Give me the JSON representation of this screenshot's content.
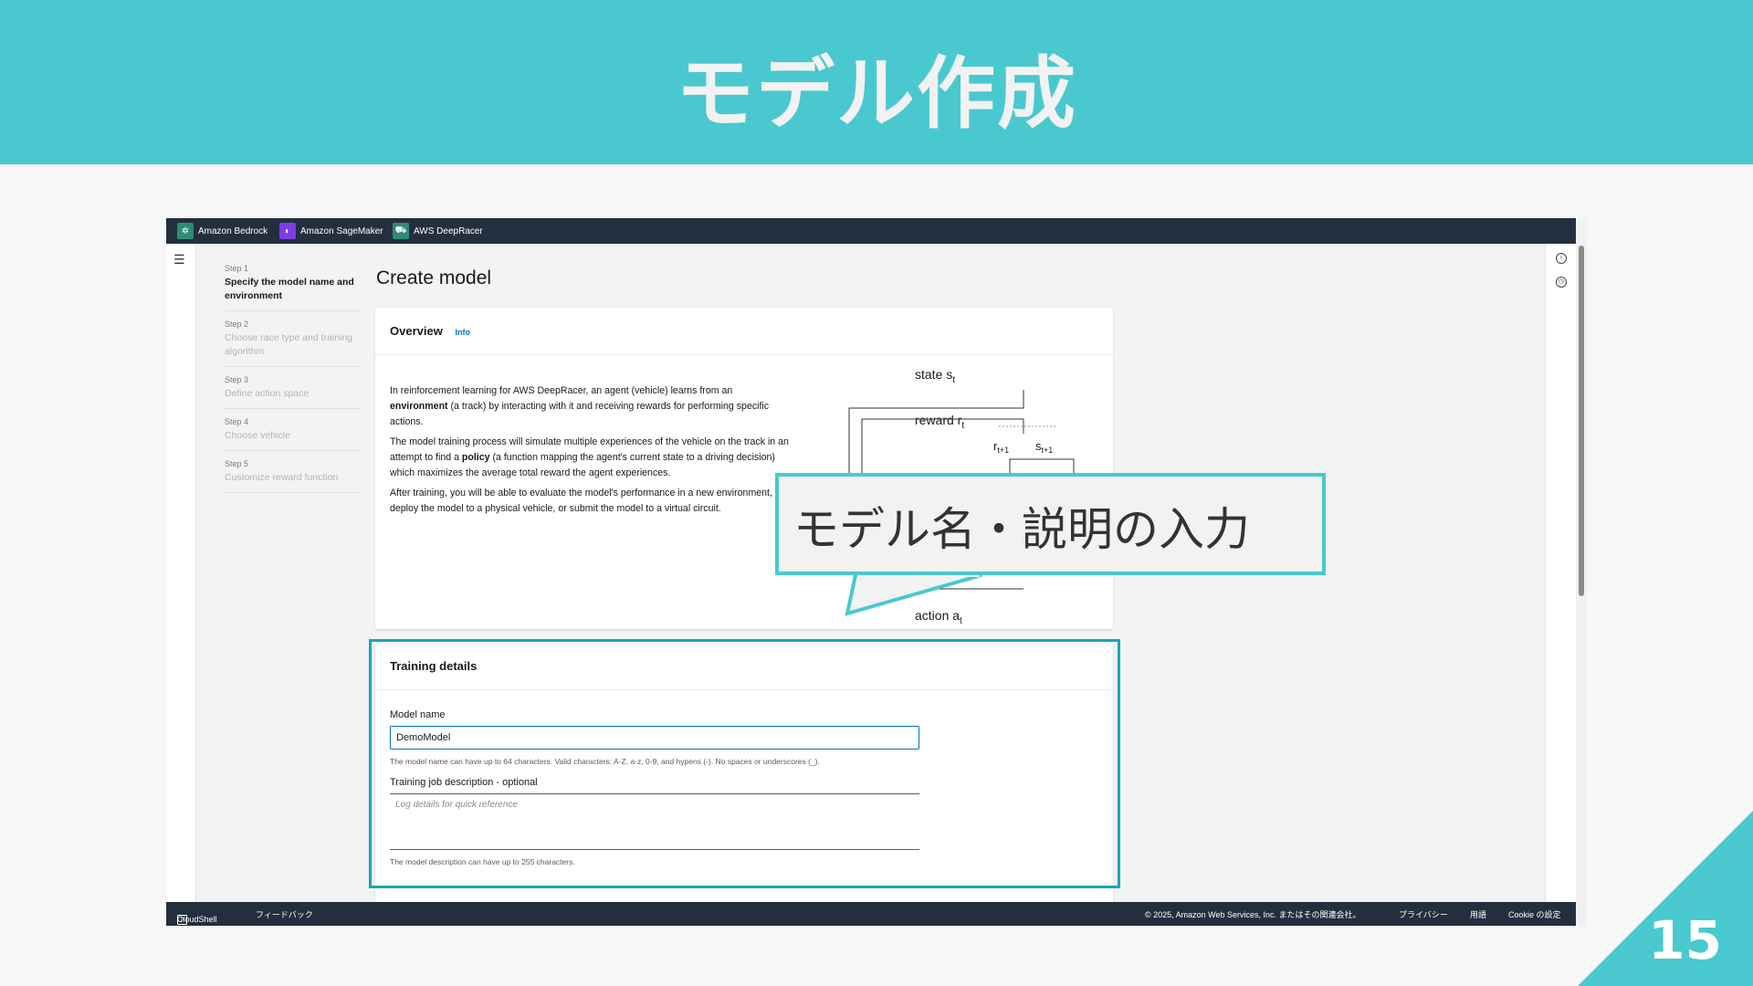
{
  "slide": {
    "title": "モデル作成",
    "page_number": "15",
    "accent_color": "#4ac8cf"
  },
  "callout": {
    "text": "モデル名・説明の入力"
  },
  "console": {
    "top_nav": [
      {
        "label": "Amazon Bedrock",
        "icon": "bedrock-icon",
        "color": "#2e8b77"
      },
      {
        "label": "Amazon SageMaker",
        "icon": "sagemaker-icon",
        "color": "#7b3fe4"
      },
      {
        "label": "AWS DeepRacer",
        "icon": "deepracer-icon",
        "color": "#2e8b77"
      }
    ],
    "page_heading": "Create model",
    "steps": [
      {
        "number": "Step 1",
        "label": "Specify the model name and environment",
        "active": true
      },
      {
        "number": "Step 2",
        "label": "Choose race type and training algorithm",
        "active": false
      },
      {
        "number": "Step 3",
        "label": "Define action space",
        "active": false
      },
      {
        "number": "Step 4",
        "label": "Choose vehicle",
        "active": false
      },
      {
        "number": "Step 5",
        "label": "Customize reward function",
        "active": false
      }
    ],
    "overview": {
      "title": "Overview",
      "info": "Info",
      "p1_a": "In reinforcement learning for AWS DeepRacer, an agent (vehicle) learns from an ",
      "p1_b": "environment",
      "p1_c": " (a track) by interacting with it and receiving rewards for performing specific actions.",
      "p2_a": "The model training process will simulate multiple experiences of the vehicle on the track in an attempt to find a ",
      "p2_b": "policy",
      "p2_c": " (a function mapping the agent's current state to a driving decision) which maximizes the average total reward the agent experiences.",
      "p3": "After training, you will be able to evaluate the model's performance in a new environment, deploy the model to a physical vehicle, or submit the model to a virtual circuit.",
      "diagram": {
        "state": "state s",
        "state_sub": "t",
        "reward": "reward r",
        "reward_sub": "t",
        "r_next": "r",
        "r_next_sub": "t+1",
        "s_next": "s",
        "s_next_sub": "t+1",
        "action": "action a",
        "action_sub": "t"
      }
    },
    "training": {
      "title": "Training details",
      "model_name_label": "Model name",
      "model_name_value": "DemoModel",
      "model_name_hint": "The model name can have up to 64 characters. Valid characters: A-Z, a-z, 0-9, and hypens (-). No spaces or underscores (_).",
      "description_label": "Training job description - optional",
      "description_placeholder": "Log details for quick reference",
      "description_hint": "The model description can have up to 255 characters."
    },
    "footer": {
      "cloudshell": "CloudShell",
      "feedback": "フィードバック",
      "copyright": "© 2025, Amazon Web Services, Inc. またはその関連会社。",
      "privacy": "プライバシー",
      "terms": "用語",
      "cookie": "Cookie の設定"
    }
  }
}
